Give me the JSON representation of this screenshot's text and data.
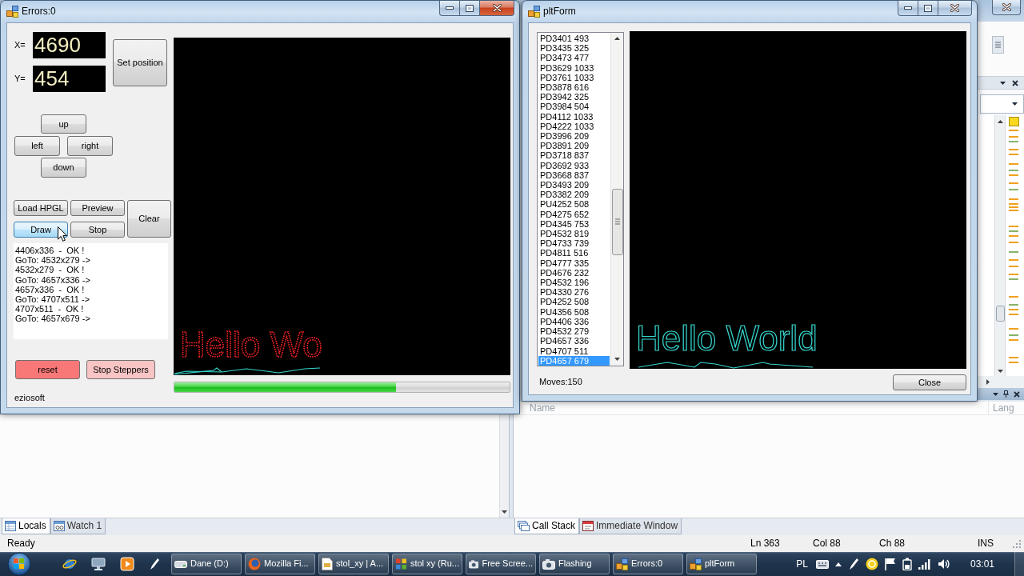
{
  "errors_window": {
    "title": "Errors:0",
    "active": true,
    "coordinates": [
      {
        "label": "X=",
        "value": "4690"
      },
      {
        "label": "Y=",
        "value": "454"
      }
    ],
    "set_position_button": "Set position",
    "jog_buttons": [
      "up",
      "left",
      "right",
      "down"
    ],
    "plot_buttons": [
      {
        "label": "Load HPGL",
        "hovered": false
      },
      {
        "label": "Preview",
        "hovered": false
      },
      {
        "label": "Clear",
        "hovered": false
      },
      {
        "label": "Draw",
        "hovered": true
      },
      {
        "label": "Stop",
        "hovered": false
      }
    ],
    "log_lines": [
      "4406x336  -  OK !",
      "GoTo: 4532x279 ->",
      "4532x279  -  OK !",
      "GoTo: 4657x336 ->",
      "4657x336  -  OK !",
      "GoTo: 4707x511 ->",
      "4707x511  -  OK !",
      "GoTo: 4657x679 ->"
    ],
    "stepper_buttons": [
      {
        "label": "reset",
        "color": "#f87878"
      },
      {
        "label": "Stop Steppers",
        "color": "#f8c4c4"
      }
    ],
    "footer": "eziosoft",
    "plot_text": "Hello Wo",
    "progress": {
      "level": 0.66
    }
  },
  "plot_window": {
    "title": "pltForm",
    "active": false,
    "commands": [
      {
        "text": "PD3401 493",
        "selected": false
      },
      {
        "text": "PD3435 325",
        "selected": false
      },
      {
        "text": "PD3473 477",
        "selected": false
      },
      {
        "text": "PD3629 1033",
        "selected": false
      },
      {
        "text": "PD3761 1033",
        "selected": false
      },
      {
        "text": "PD3878 616",
        "selected": false
      },
      {
        "text": "PD3942 325",
        "selected": false
      },
      {
        "text": "PD3984 504",
        "selected": false
      },
      {
        "text": "PD4112 1033",
        "selected": false
      },
      {
        "text": "PD4222 1033",
        "selected": false
      },
      {
        "text": "PD3996 209",
        "selected": false
      },
      {
        "text": "PD3891 209",
        "selected": false
      },
      {
        "text": "PD3718 837",
        "selected": false
      },
      {
        "text": "PD3692 933",
        "selected": false
      },
      {
        "text": "PD3668 837",
        "selected": false
      },
      {
        "text": "PD3493 209",
        "selected": false
      },
      {
        "text": "PD3382 209",
        "selected": false
      },
      {
        "text": "PU4252 508",
        "selected": false
      },
      {
        "text": "PD4275 652",
        "selected": false
      },
      {
        "text": "PD4345 753",
        "selected": false
      },
      {
        "text": "PD4532 819",
        "selected": false
      },
      {
        "text": "PD4733 739",
        "selected": false
      },
      {
        "text": "PD4811 516",
        "selected": false
      },
      {
        "text": "PD4777 335",
        "selected": false
      },
      {
        "text": "PD4676 232",
        "selected": false
      },
      {
        "text": "PD4532 196",
        "selected": false
      },
      {
        "text": "PD4330 276",
        "selected": false
      },
      {
        "text": "PD4252 508",
        "selected": false
      },
      {
        "text": "PU4356 508",
        "selected": false
      },
      {
        "text": "PD4406 336",
        "selected": false
      },
      {
        "text": "PD4532 279",
        "selected": false
      },
      {
        "text": "PD4657 336",
        "selected": false
      },
      {
        "text": "PD4707 511",
        "selected": false
      },
      {
        "text": "PD4657 679",
        "selected": true
      }
    ],
    "plot_text": "Hello World",
    "moves": "Moves:150",
    "close_button": "Close"
  },
  "ide": {
    "right_pane_columns": [
      "Name",
      "Lang"
    ],
    "left_tabs": [
      {
        "label": "Locals",
        "selected": true
      },
      {
        "label": "Watch 1",
        "selected": false
      }
    ],
    "right_tabs": [
      {
        "label": "Call Stack",
        "selected": true
      },
      {
        "label": "Immediate Window",
        "selected": false
      }
    ],
    "status_bar": {
      "message": "Ready",
      "line": "Ln 363",
      "column": "Col 88",
      "char": "Ch 88",
      "mode": "INS"
    }
  },
  "taskbar": {
    "tasks": [
      "Dane (D:)",
      "Mozilla Fi...",
      "stol_xy | A...",
      "stol xy (Ru...",
      "Free Scree...",
      "Flashing",
      "Errors:0",
      "pltForm"
    ],
    "language": "PL",
    "clock": "03:01"
  }
}
